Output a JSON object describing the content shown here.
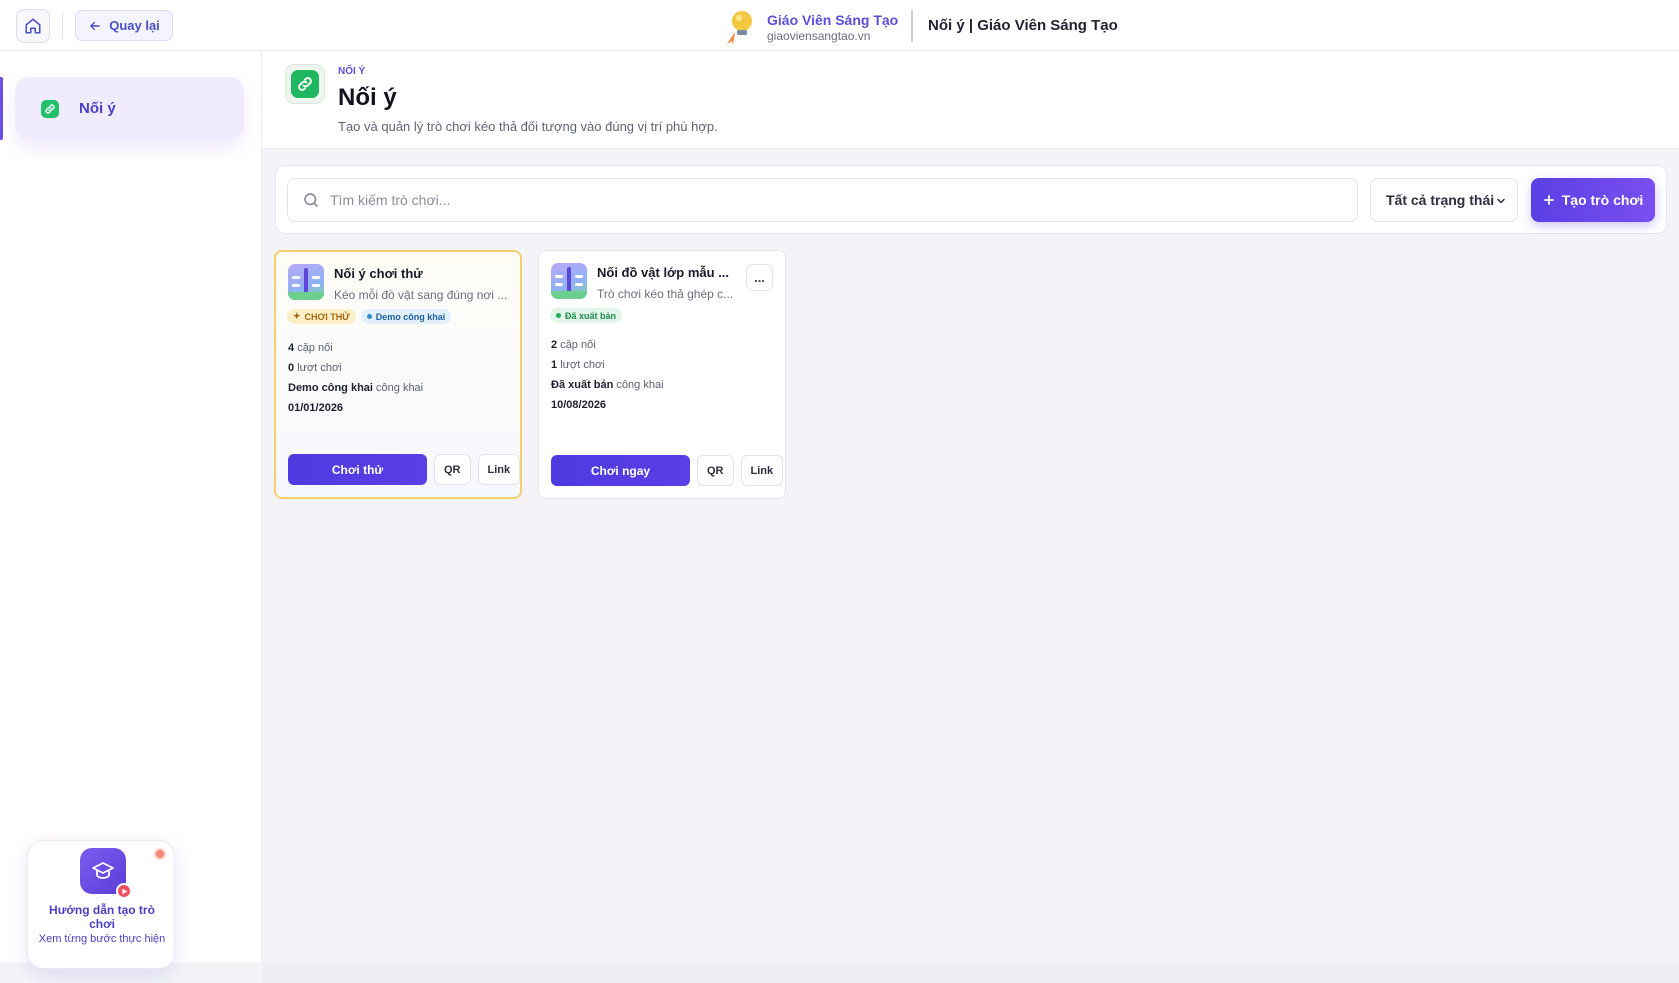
{
  "topbar": {
    "home_icon": "home-icon",
    "back_label": "Quay lại",
    "brand_name": "Giáo Viên Sáng Tạo",
    "brand_url": "giaoviensangtao.vn",
    "page_heading": "Nối ý | Giáo Viên Sáng Tạo"
  },
  "sidebar": {
    "items": [
      {
        "label": "Nối ý",
        "icon": "link-icon",
        "active": true
      }
    ]
  },
  "header": {
    "eyebrow": "NỐI Ý",
    "title": "Nối ý",
    "description": "Tạo và quản lý trò chơi kéo thả đối tượng vào đúng vị trí phù hợp."
  },
  "toolbar": {
    "search_placeholder": "Tìm kiếm trò chơi...",
    "status_selected": "Tất cả trạng thái",
    "create_label": "Tạo trò chơi"
  },
  "cards": [
    {
      "title": "Nối ý chơi thử",
      "subtitle": "Kéo mỗi đồ vật sang đúng nơi ...",
      "badge1": "CHƠI THỬ",
      "badge2": "Demo công khai",
      "pairs_count": "4",
      "pairs_label": "cặp nối",
      "plays_count": "0",
      "plays_label": "lượt chơi",
      "visibility_strong": "Demo công khai",
      "visibility_label": "công khai",
      "date": "01/01/2026",
      "primary_action": "Chơi thử",
      "qr_label": "QR",
      "link_label": "Link"
    },
    {
      "title": "Nối đồ vật lớp mẫu ...",
      "subtitle": "Trò chơi kéo thả ghép c...",
      "more_label": "...",
      "badge1": "Đã xuất bản",
      "pairs_count": "2",
      "pairs_label": "cặp nối",
      "plays_count": "1",
      "plays_label": "lượt chơi",
      "visibility_strong": "Đã xuất bản",
      "visibility_label": "công khai",
      "date": "10/08/2026",
      "primary_action": "Chơi ngay",
      "qr_label": "QR",
      "link_label": "Link"
    }
  ],
  "help": {
    "title": "Hướng dẫn tạo trò chơi",
    "subtitle": "Xem từng bước thực hiện",
    "icon": "graduation-cap-icon"
  },
  "colors": {
    "accent": "#5b3fe4",
    "brand_text": "#5b4fd9",
    "success": "#1fb860",
    "trial_border": "#f6cf6e"
  }
}
